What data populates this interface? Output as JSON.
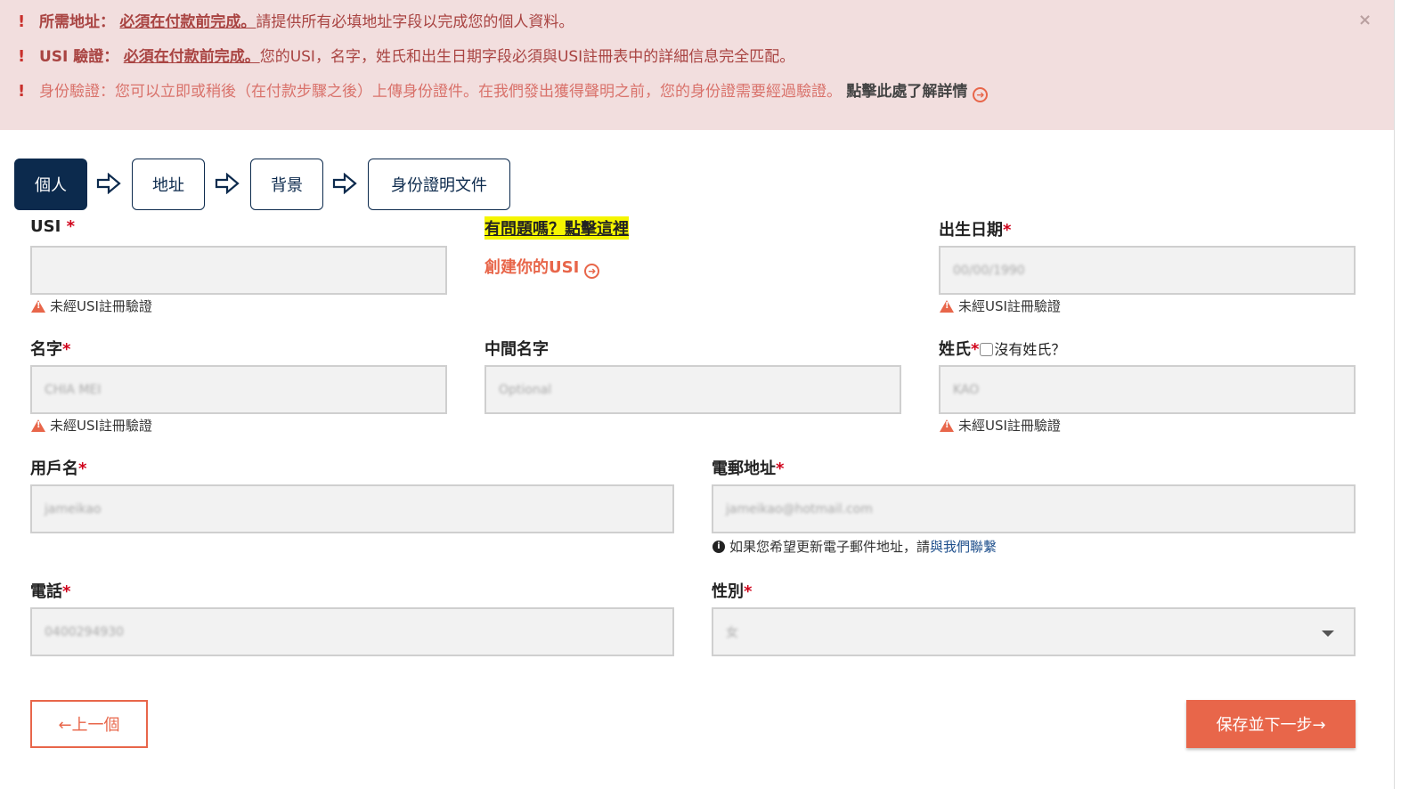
{
  "alerts": [
    {
      "label": "所需地址：",
      "emphasis": "必須在付款前完成。",
      "text": "請提供所有必填地址字段以完成您的個人資料。"
    },
    {
      "label": "USI 驗證：",
      "emphasis": "必須在付款前完成。",
      "text": "您的USI，名字，姓氏和出生日期字段必須與USI註冊表中的詳細信息完全匹配。"
    },
    {
      "label": "身份驗證：",
      "text": "您可以立即或稍後（在付款步驟之後）上傳身份證件。在我們發出獲得聲明之前，您的身份證需要經過驗證。",
      "link": "點擊此處了解詳情"
    }
  ],
  "alert_close": "×",
  "steps": [
    "個人",
    "地址",
    "背景",
    "身份證明文件"
  ],
  "fields": {
    "usi": {
      "label": "USI",
      "value": "",
      "hint": "未經USI註冊驗證"
    },
    "help_link": "有問題嗎？點擊這裡",
    "create_usi": "創建你的USI",
    "dob": {
      "label": "出生日期",
      "value": "00/00/1990",
      "hint": "未經USI註冊驗證"
    },
    "first_name": {
      "label": "名字",
      "value": "CHIA MEI",
      "hint": "未經USI註冊驗證"
    },
    "middle_name": {
      "label": "中間名字",
      "placeholder": "Optional"
    },
    "surname": {
      "label": "姓氏",
      "no_surname": "沒有姓氏？",
      "value": "KAO",
      "hint": "未經USI註冊驗證"
    },
    "username": {
      "label": "用戶名",
      "value": "jameikao"
    },
    "email": {
      "label": "電郵地址",
      "value": "jameikao@hotmail.com",
      "hint_prefix": "如果您希望更新電子郵件地址，請",
      "hint_link": "與我們聯繫"
    },
    "phone": {
      "label": "電話",
      "value": "0400294930"
    },
    "gender": {
      "label": "性別",
      "value": "女"
    }
  },
  "required_mark": "*",
  "buttons": {
    "prev": "←上一個",
    "next": "保存並下一步→"
  },
  "colors": {
    "navy": "#0c2a4d",
    "accent": "#e8664a",
    "alert_bg": "#f2dede",
    "alert_text": "#a94442",
    "required": "#d0021b"
  }
}
